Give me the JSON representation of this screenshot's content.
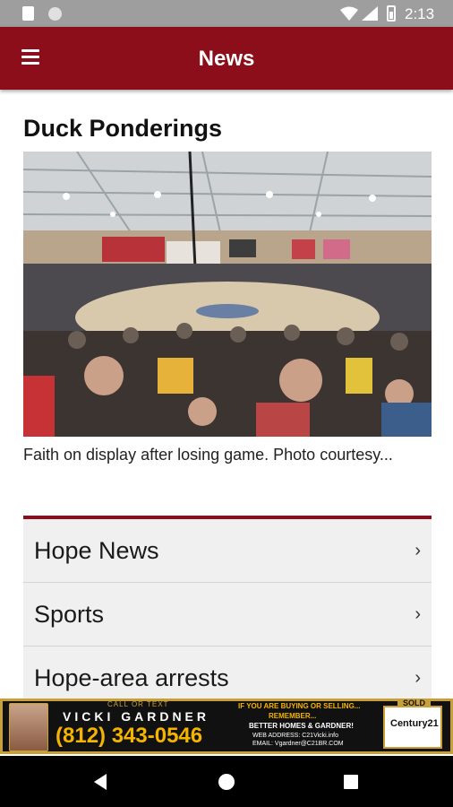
{
  "status_bar": {
    "time": "2:13"
  },
  "app_bar": {
    "title": "News"
  },
  "feature": {
    "title": "Duck Ponderings",
    "caption": "Faith on display after losing game. Photo courtesy..."
  },
  "nav_list": [
    {
      "label": "Hope News",
      "chevron": "›"
    },
    {
      "label": "Sports",
      "chevron": "›"
    },
    {
      "label": "Hope-area arrests",
      "chevron": "›"
    }
  ],
  "ad": {
    "call_text": "CALL OR TEXT",
    "agent_name": "VICKI GARDNER",
    "phone": "(812) 343-0546",
    "line1": "IF YOU ARE BUYING OR SELLING...",
    "line2": "REMEMBER...",
    "line3": "BETTER HOMES & GARDNER!",
    "line4": "WEB ADDRESS: C21Vicki.info",
    "line5": "EMAIL: Vgardner@C21BR.COM",
    "sold": "SOLD",
    "brand": "Century21"
  },
  "colors": {
    "brand": "#8b0e1a",
    "status_bar": "#9e9e9e",
    "list_bg": "#f0f0f0",
    "ad_gold": "#c8a037"
  },
  "icons": {
    "menu": "hamburger-menu-icon",
    "chevron": "chevron-right-icon",
    "back": "back-triangle-icon",
    "home": "home-circle-icon",
    "recents": "recents-square-icon"
  }
}
